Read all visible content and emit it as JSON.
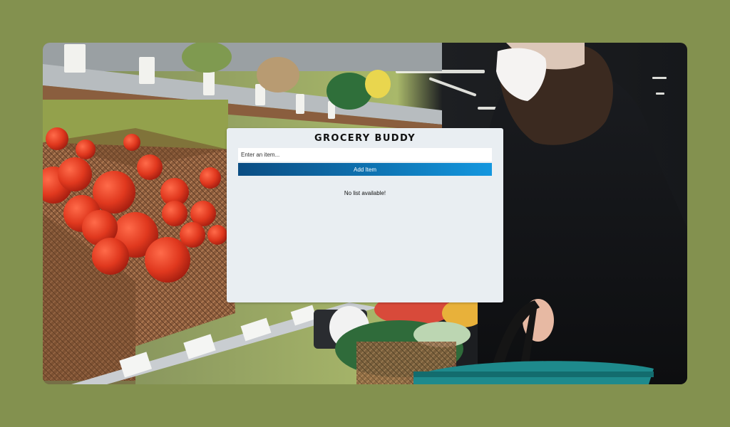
{
  "app": {
    "title": "GROCERY BUDDY"
  },
  "form": {
    "input_placeholder": "Enter an item...",
    "input_value": "",
    "add_button_label": "Add Item"
  },
  "list": {
    "empty_message": "No list available!",
    "items": []
  },
  "colors": {
    "page_background": "#83914f",
    "card_background": "#e9eef2",
    "button_gradient_start": "#0b4d83",
    "button_gradient_end": "#1497df"
  }
}
